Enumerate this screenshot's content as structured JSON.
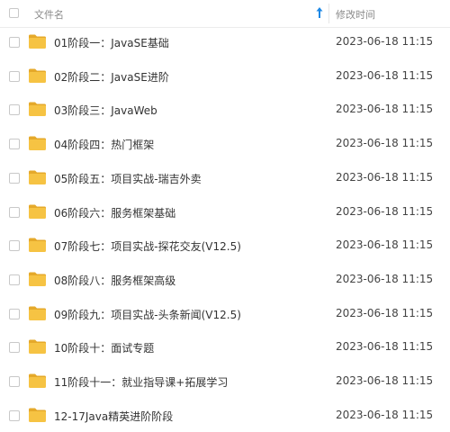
{
  "header": {
    "name_label": "文件名",
    "time_label": "修改时间",
    "sort_icon": "arrow-up-icon"
  },
  "colors": {
    "folder_body": "#F6C343",
    "folder_back": "#E5A92A",
    "sort_arrow": "#1e88e5"
  },
  "rows": [
    {
      "name": "01阶段一：JavaSE基础",
      "time": "2023-06-18 11:15"
    },
    {
      "name": "02阶段二：JavaSE进阶",
      "time": "2023-06-18 11:15"
    },
    {
      "name": "03阶段三：JavaWeb",
      "time": "2023-06-18 11:15"
    },
    {
      "name": "04阶段四：热门框架",
      "time": "2023-06-18 11:15"
    },
    {
      "name": "05阶段五：项目实战-瑞吉外卖",
      "time": "2023-06-18 11:15"
    },
    {
      "name": "06阶段六：服务框架基础",
      "time": "2023-06-18 11:15"
    },
    {
      "name": "07阶段七：项目实战-探花交友(V12.5)",
      "time": "2023-06-18 11:15"
    },
    {
      "name": "08阶段八：服务框架高级",
      "time": "2023-06-18 11:15"
    },
    {
      "name": "09阶段九：项目实战-头条新闻(V12.5)",
      "time": "2023-06-18 11:15"
    },
    {
      "name": "10阶段十：面试专题",
      "time": "2023-06-18 11:15"
    },
    {
      "name": "11阶段十一：就业指导课+拓展学习",
      "time": "2023-06-18 11:15"
    },
    {
      "name": "12-17Java精英进阶阶段",
      "time": "2023-06-18 11:15"
    }
  ]
}
